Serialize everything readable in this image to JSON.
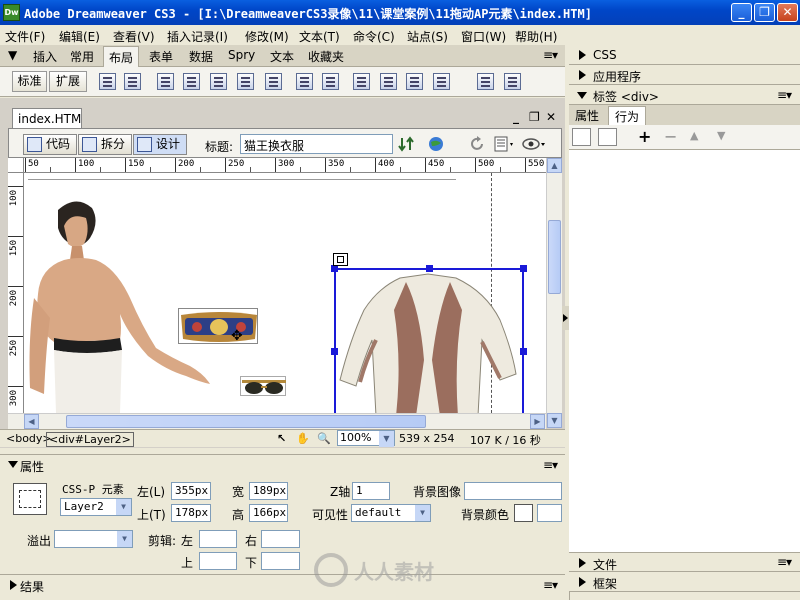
{
  "window": {
    "app_icon": "Dw",
    "title": "Adobe Dreamweaver CS3 - [I:\\DreamweaverCS3录像\\11\\课堂案例\\11拖动AP元素\\index.HTM]"
  },
  "menu": [
    "文件(F)",
    "编辑(E)",
    "查看(V)",
    "插入记录(I)",
    "修改(M)",
    "文本(T)",
    "命令(C)",
    "站点(S)",
    "窗口(W)",
    "帮助(H)"
  ],
  "insert_bar": {
    "label": "插入",
    "tabs": [
      "常用",
      "布局",
      "表单",
      "数据",
      "Spry",
      "文本",
      "收藏夹"
    ],
    "active_tab": "布局",
    "mode_buttons": [
      "标准",
      "扩展"
    ]
  },
  "document": {
    "tab_name": "index.HTM",
    "view_buttons": [
      "代码",
      "拆分",
      "设计"
    ],
    "title_label": "标题:",
    "title_value": "猫王换衣服"
  },
  "ruler": {
    "h_labels": [
      "50",
      "100",
      "150",
      "200",
      "250",
      "300",
      "350",
      "400",
      "450",
      "500",
      "550"
    ],
    "v_labels": [
      "100",
      "150",
      "200",
      "250",
      "300"
    ]
  },
  "status": {
    "tag_path": [
      "<body>",
      "<div#Layer2>"
    ],
    "zoom": "100%",
    "dimensions": "539 x 254",
    "size_time": "107 K / 16 秒"
  },
  "properties": {
    "header": "属性",
    "element_type": "CSS-P 元素",
    "layer_name": "Layer2",
    "left_label": "左(L)",
    "left_value": "355px",
    "top_label": "上(T)",
    "top_value": "178px",
    "width_label": "宽",
    "width_value": "189px",
    "height_label": "高",
    "height_value": "166px",
    "z_label": "Z轴",
    "z_value": "1",
    "visibility_label": "可见性",
    "visibility_value": "default",
    "bg_image_label": "背景图像",
    "bg_color_label": "背景颜色",
    "overflow_label": "溢出",
    "clip_label": "剪辑:",
    "clip_left": "左",
    "clip_right": "右",
    "clip_top": "上",
    "clip_bottom": "下"
  },
  "results_panel": "结果",
  "right_panel": {
    "css": "CSS",
    "app": "应用程序",
    "tag_inspector": "标签 <div>",
    "tabs": [
      "属性",
      "行为"
    ],
    "active_tab": "行为",
    "files": "文件",
    "frames": "框架"
  },
  "watermark": "人人素材",
  "colors": {
    "titlebar": "#0a5fe0",
    "selection_border": "#1a1ad8",
    "chrome": "#ece9d8"
  }
}
